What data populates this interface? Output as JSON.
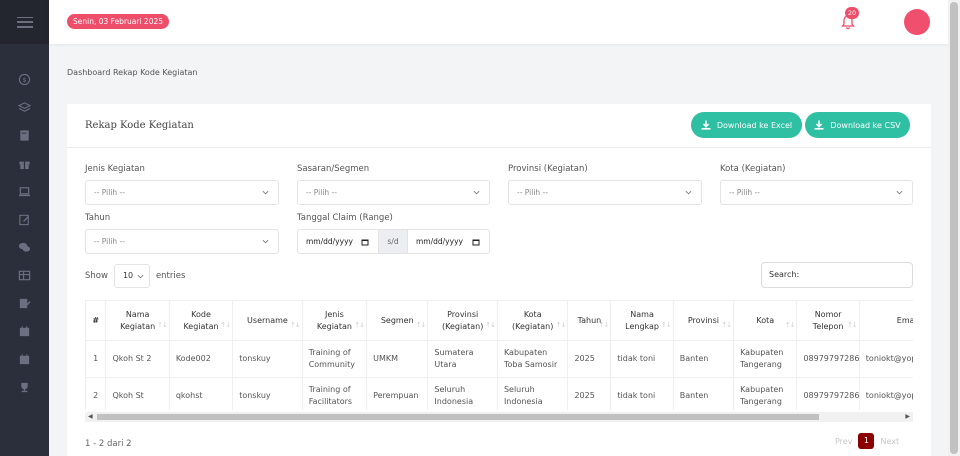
{
  "header": {
    "date": "Senin, 03 Februari 2025",
    "notif_count": "20"
  },
  "sidebar": {
    "icons": [
      "dollar-icon",
      "layers-icon",
      "book-icon",
      "gift-icon",
      "laptop-icon",
      "edit-icon",
      "chat-icon",
      "table-icon",
      "checklist-icon",
      "calendar-icon",
      "calendar-icon",
      "trophy-icon"
    ]
  },
  "breadcrumb": "Dashboard Rekap Kode Kegiatan",
  "card": {
    "title": "Rekap Kode Kegiatan",
    "btn_excel": "Download ke Excel",
    "btn_csv": "Download ke CSV"
  },
  "filters": {
    "jenis_label": "Jenis Kegiatan",
    "sasaran_label": "Sasaran/Segmen",
    "provinsi_label": "Provinsi (Kegiatan)",
    "kota_label": "Kota (Kegiatan)",
    "tahun_label": "Tahun",
    "tanggal_label": "Tanggal Claim (Range)",
    "placeholder": "-- Pilih --",
    "date_from": "mm/dd/yyyy",
    "sd": "s/d",
    "date_to": "mm/dd/yyyy"
  },
  "table_controls": {
    "show": "Show",
    "entries_value": "10",
    "entries": "entries",
    "search": "Search:"
  },
  "table": {
    "headers": [
      "#",
      "Nama Kegiatan",
      "Kode Kegiatan",
      "Username",
      "Jenis Kegiatan",
      "Segmen",
      "Provinsi (Kegiatan)",
      "Kota (Kegiatan)",
      "Tahun",
      "Nama Lengkap",
      "Provinsi",
      "Kota",
      "Nomor Telepon",
      "Email"
    ],
    "rows": [
      [
        "1",
        "Qkoh St 2",
        "Kode002",
        "tonskuy",
        "Training of Community",
        "UMKM",
        "Sumatera Utara",
        "Kabupaten Toba Samosir",
        "2025",
        "tidak toni",
        "Banten",
        "Kabupaten Tangerang",
        "08979797286",
        "toniokt@yopmail.com"
      ],
      [
        "2",
        "Qkoh St",
        "qkohst",
        "tonskuy",
        "Training of Facilitators",
        "Perempuan",
        "Seluruh Indonesia",
        "Seluruh Indonesia",
        "2025",
        "tidak toni",
        "Banten",
        "Kabupaten Tangerang",
        "08979797286",
        "toniokt@yopmail.com"
      ]
    ]
  },
  "footer": {
    "info": "1 - 2 dari 2",
    "prev": "Prev",
    "page": "1",
    "next": "Next"
  },
  "colors": {
    "sidebar": "#2b2e3b",
    "accent_pink": "#ee4e69",
    "accent_teal": "#2fbfa3",
    "pager_active": "#8b0000"
  }
}
